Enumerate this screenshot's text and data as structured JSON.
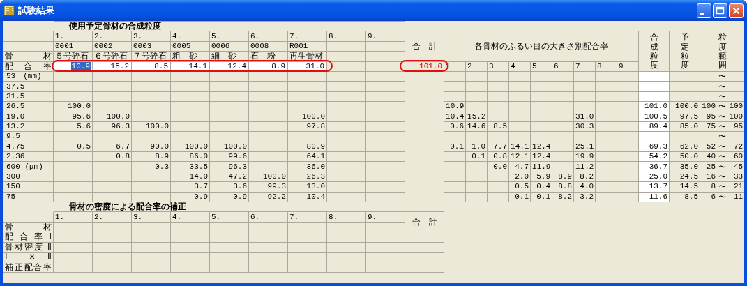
{
  "window": {
    "title": "試験結果"
  },
  "upper": {
    "title": "使用予定骨材の合成粒度",
    "columns": [
      {
        "number": "1.",
        "code": "0001",
        "name": "５号砕石"
      },
      {
        "number": "2.",
        "code": "0002",
        "name": "６号砕石"
      },
      {
        "number": "3.",
        "code": "0003",
        "name": "７号砕石"
      },
      {
        "number": "4.",
        "code": "0005",
        "name": "粗　砂"
      },
      {
        "number": "5.",
        "code": "0006",
        "name": "細　砂"
      },
      {
        "number": "6.",
        "code": "0008",
        "name": "石　粉"
      },
      {
        "number": "7.",
        "code": "R001",
        "name": "再生骨材"
      },
      {
        "number": "8."
      },
      {
        "number": "9."
      }
    ],
    "material_label": "骨 材",
    "rate_label": "配 合 率",
    "rates": [
      {
        "value": "10.9",
        "selected": true
      },
      {
        "value": "15.2",
        "selected": false
      },
      {
        "value": "8.5",
        "selected": false
      },
      {
        "value": "14.1",
        "selected": false
      },
      {
        "value": "12.4",
        "selected": false
      },
      {
        "value": "8.9",
        "selected": false
      },
      {
        "value": "31.0",
        "selected": false
      }
    ],
    "rates_highlighted": true,
    "total_label": "合　計",
    "total": {
      "value": "101.0",
      "highlighted": true
    },
    "sieve_header": "各骨材のふるい目の大きさ別配合率",
    "sieve_columns": [
      "1",
      "2",
      "3",
      "4",
      "5",
      "6",
      "7",
      "8",
      "9"
    ],
    "combined_header": "合成粒度",
    "planned_header": "予定粒度",
    "range_header": "粒度範囲",
    "rows": [
      {
        "sieve": "53　(mm)",
        "range_sep": "〜"
      },
      {
        "sieve": "37.5",
        "range_sep": "〜"
      },
      {
        "sieve": "31.5",
        "range_sep": "〜"
      },
      {
        "sieve": "26.5",
        "values": {
          "1": "100.0"
        },
        "parts": {
          "1": "10.9"
        },
        "combined": "101.0",
        "planned": "100.0",
        "range_low": "100",
        "range_sep": "〜",
        "range_high": "100"
      },
      {
        "sieve": "19.0",
        "values": {
          "1": "95.6",
          "2": "100.0",
          "7": "100.0"
        },
        "parts": {
          "1": "10.4",
          "2": "15.2",
          "7": "31.0"
        },
        "combined": "100.5",
        "planned": "97.5",
        "range_low": "95",
        "range_sep": "〜",
        "range_high": "100"
      },
      {
        "sieve": "13.2",
        "values": {
          "1": "5.6",
          "2": "96.3",
          "3": "100.0",
          "7": "97.8"
        },
        "parts": {
          "1": "0.6",
          "2": "14.6",
          "3": "8.5",
          "7": "30.3"
        },
        "combined": "89.4",
        "planned": "85.0",
        "range_low": "75",
        "range_sep": "〜",
        "range_high": "95"
      },
      {
        "sieve": "9.5",
        "range_sep": "〜"
      },
      {
        "sieve": "4.75",
        "values": {
          "1": "0.5",
          "2": "6.7",
          "3": "90.0",
          "4": "100.0",
          "5": "100.0",
          "7": "80.9"
        },
        "parts": {
          "1": "0.1",
          "2": "1.0",
          "3": "7.7",
          "4": "14.1",
          "5": "12.4",
          "7": "25.1"
        },
        "combined": "69.3",
        "planned": "62.0",
        "range_low": "52",
        "range_sep": "〜",
        "range_high": "72"
      },
      {
        "sieve": "2.36",
        "values": {
          "2": "0.8",
          "3": "8.9",
          "4": "86.0",
          "5": "99.6",
          "7": "64.1"
        },
        "parts": {
          "2": "0.1",
          "3": "0.8",
          "4": "12.1",
          "5": "12.4",
          "7": "19.9"
        },
        "combined": "54.2",
        "planned": "50.0",
        "range_low": "40",
        "range_sep": "〜",
        "range_high": "60"
      },
      {
        "sieve": "600 (μm)",
        "values": {
          "3": "0.3",
          "4": "33.5",
          "5": "96.3",
          "7": "36.0"
        },
        "parts": {
          "3": "0.0",
          "4": "4.7",
          "5": "11.9",
          "7": "11.2"
        },
        "combined": "36.7",
        "planned": "35.0",
        "range_low": "25",
        "range_sep": "〜",
        "range_high": "45"
      },
      {
        "sieve": "300",
        "values": {
          "4": "14.0",
          "5": "47.2",
          "6": "100.0",
          "7": "26.3"
        },
        "parts": {
          "4": "2.0",
          "5": "5.9",
          "6": "8.9",
          "7": "8.2"
        },
        "combined": "25.0",
        "planned": "24.5",
        "range_low": "16",
        "range_sep": "〜",
        "range_high": "33"
      },
      {
        "sieve": "150",
        "values": {
          "4": "3.7",
          "5": "3.6",
          "6": "99.3",
          "7": "13.0"
        },
        "parts": {
          "4": "0.5",
          "5": "0.4",
          "6": "8.8",
          "7": "4.0"
        },
        "combined": "13.7",
        "planned": "14.5",
        "range_low": "8",
        "range_sep": "〜",
        "range_high": "21"
      },
      {
        "sieve": "75",
        "values": {
          "4": "0.9",
          "5": "0.9",
          "6": "92.2",
          "7": "10.4"
        },
        "parts": {
          "4": "0.1",
          "5": "0.1",
          "6": "8.2",
          "7": "3.2"
        },
        "combined": "11.6",
        "planned": "8.5",
        "range_low": "6",
        "range_sep": "〜",
        "range_high": "11"
      }
    ]
  },
  "lower": {
    "title": "骨材の密度による配合率の補正",
    "columns": [
      "1.",
      "2.",
      "3.",
      "4.",
      "5.",
      "6.",
      "7.",
      "8.",
      "9."
    ],
    "total_label": "合　計",
    "row_labels": [
      "骨 材",
      "配 合 率 Ⅰ",
      "骨材密度 Ⅱ",
      "Ⅰ × Ⅱ",
      "補正配合率"
    ]
  }
}
